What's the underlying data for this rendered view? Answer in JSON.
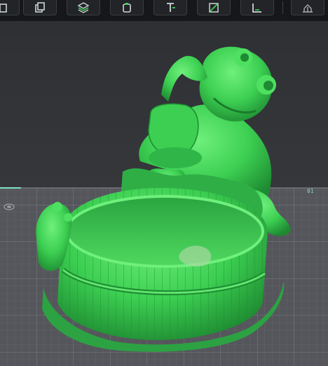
{
  "toolbar": {
    "buttons": [
      {
        "name": "tool-1-icon"
      },
      {
        "name": "copy-icon"
      },
      {
        "name": "layers-icon"
      },
      {
        "name": "bucket-icon"
      },
      {
        "name": "text-icon"
      },
      {
        "name": "draw-icon"
      },
      {
        "name": "measure-icon"
      },
      {
        "name": "support-icon"
      }
    ]
  },
  "viewport": {
    "plate_number": "01",
    "model_color": "#3ccf52",
    "bed_color": "#56575c",
    "accent_color": "#7fe0c0"
  }
}
